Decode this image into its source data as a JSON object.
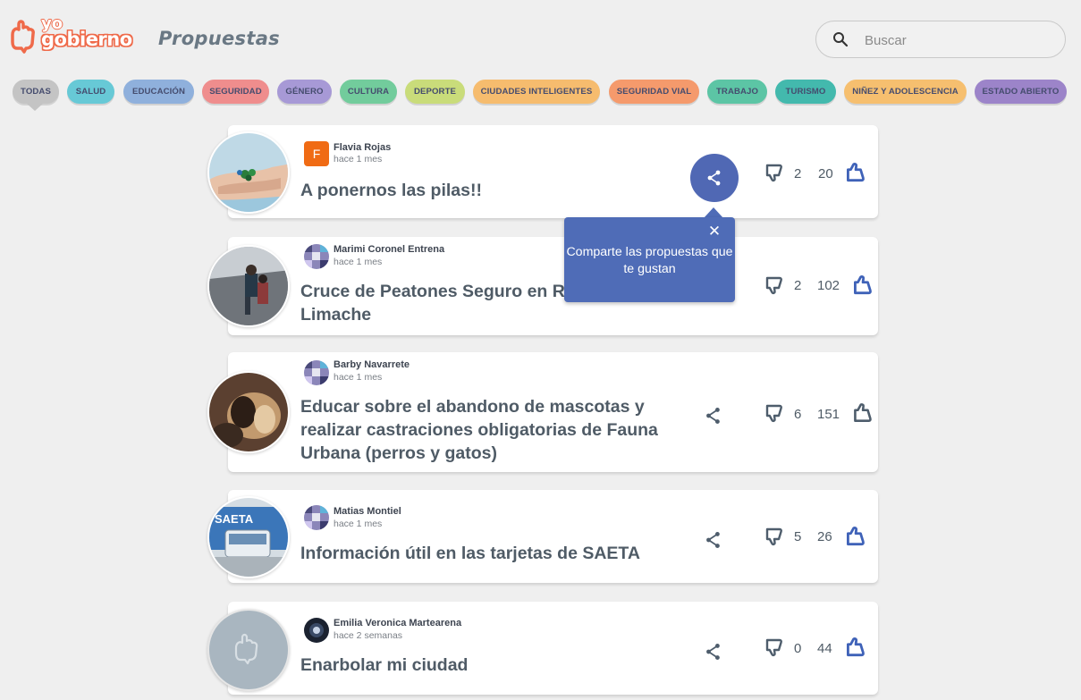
{
  "header": {
    "logo_top": "yo",
    "logo_bottom": "gobierno",
    "title": "Propuestas",
    "search_placeholder": "Buscar"
  },
  "categories": [
    {
      "label": "TODAS",
      "color": "#c4c4c4",
      "active": true
    },
    {
      "label": "SALUD",
      "color": "#67c9d6"
    },
    {
      "label": "EDUCACIÓN",
      "color": "#8fb0dc"
    },
    {
      "label": "SEGURIDAD",
      "color": "#ef8d8d"
    },
    {
      "label": "GÉNERO",
      "color": "#a799d6"
    },
    {
      "label": "CULTURA",
      "color": "#72cc9c"
    },
    {
      "label": "DEPORTE",
      "color": "#c9dc7a"
    },
    {
      "label": "CIUDADES INTELIGENTES",
      "color": "#f6bc6e"
    },
    {
      "label": "SEGURIDAD VIAL",
      "color": "#f59a6c"
    },
    {
      "label": "TRABAJO",
      "color": "#5cc5a5"
    },
    {
      "label": "TURISMO",
      "color": "#43b9ad"
    },
    {
      "label": "NIÑEZ Y ADOLESCENCIA",
      "color": "#f6bf6f"
    },
    {
      "label": "ESTADO ABIERTO",
      "color": "#9c84c9"
    }
  ],
  "tooltip": {
    "close": "✕",
    "text": "Comparte las propuestas que te gustan"
  },
  "proposals": [
    {
      "author": "Flavia Rojas",
      "time": "hace 1 mes",
      "title": "A ponernos las pilas!!",
      "dislikes": "2",
      "likes": "20",
      "avatar_letter": "F"
    },
    {
      "author": "Marimi Coronel Entrena",
      "time": "hace 1 mes",
      "title": "Cruce de Peatones Seguro en R\nLimache",
      "dislikes": "2",
      "likes": "102"
    },
    {
      "author": "Barby Navarrete",
      "time": "hace 1 mes",
      "title": "Educar sobre el abandono de mascotas y realizar castraciones obligatorias de Fauna Urbana (perros y gatos)",
      "dislikes": "6",
      "likes": "151"
    },
    {
      "author": "Matias Montiel",
      "time": "hace 1 mes",
      "title": "Información útil en las tarjetas de SAETA",
      "dislikes": "5",
      "likes": "26",
      "thumb_text": "SAETA"
    },
    {
      "author": "Emilia Veronica Martearena",
      "time": "hace 2 semanas",
      "title": "Enarbolar mi ciudad",
      "dislikes": "0",
      "likes": "44"
    }
  ]
}
